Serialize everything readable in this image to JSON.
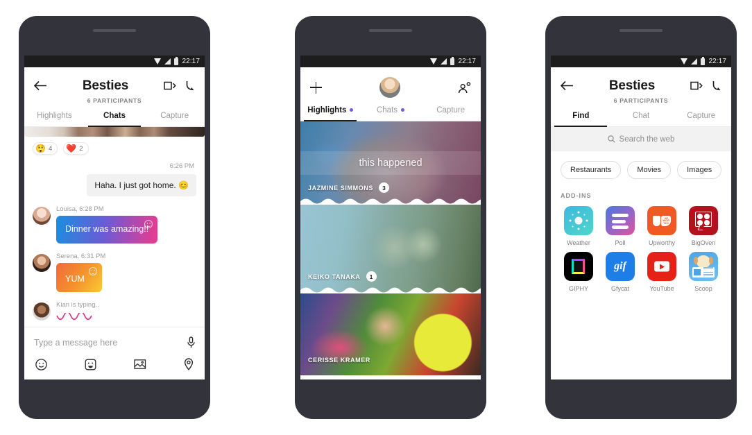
{
  "status_bar": {
    "time": "22:17",
    "wifi_icon": "wifi-icon",
    "signal_icon": "signal-icon",
    "battery_icon": "battery-icon"
  },
  "phone_chats": {
    "header": {
      "back_icon": "back-arrow-icon",
      "title": "Besties",
      "subtitle": "6 PARTICIPANTS",
      "video_icon": "video-call-icon",
      "call_icon": "phone-call-icon"
    },
    "tabs": [
      {
        "label": "Highlights",
        "active": false
      },
      {
        "label": "Chats",
        "active": true
      },
      {
        "label": "Capture",
        "active": false
      }
    ],
    "reactions": [
      {
        "emoji": "😲",
        "name": "surprised-emoji",
        "count": "4"
      },
      {
        "emoji": "❤️",
        "name": "heart-emoji",
        "count": "2"
      }
    ],
    "incoming_time": "6:26 PM",
    "incoming_text": "Haha. I just got home. 😊",
    "messages": [
      {
        "meta": "Louisa, 6:28 PM",
        "text": "Dinner was amazing!!",
        "style": "gradient-blue-pink"
      },
      {
        "meta": "Serena, 6:31 PM",
        "text": "YUM",
        "style": "gradient-orange-yellow"
      }
    ],
    "typing": {
      "text": "Kian is typing..",
      "wave_icon": "typing-wave-icon"
    },
    "composer": {
      "placeholder": "Type a message here",
      "mic_icon": "microphone-icon",
      "actions": [
        {
          "name": "emoji-icon"
        },
        {
          "name": "sticker-icon"
        },
        {
          "name": "photo-icon"
        },
        {
          "name": "location-icon"
        }
      ]
    }
  },
  "phone_highlights": {
    "header": {
      "add_icon": "plus-icon",
      "avatar": "profile-avatar",
      "add_people_icon": "add-person-icon"
    },
    "tabs": [
      {
        "label": "Highlights",
        "active": true,
        "dot": true
      },
      {
        "label": "Chats",
        "active": false,
        "dot": true
      },
      {
        "label": "Capture",
        "active": false,
        "dot": false
      }
    ],
    "cards": [
      {
        "name": "JAZMINE SIMMONS",
        "badge": "3",
        "caption": "this happened"
      },
      {
        "name": "KEIKO TANAKA",
        "badge": "1",
        "caption": ""
      },
      {
        "name": "CERISSE KRAMER",
        "badge": "",
        "caption": ""
      }
    ]
  },
  "phone_find": {
    "header": {
      "back_icon": "back-arrow-icon",
      "title": "Besties",
      "subtitle": "6 PARTICIPANTS",
      "video_icon": "video-call-icon",
      "call_icon": "phone-call-icon"
    },
    "tabs": [
      {
        "label": "Find",
        "active": true
      },
      {
        "label": "Chat",
        "active": false
      },
      {
        "label": "Capture",
        "active": false
      }
    ],
    "search": {
      "placeholder": "Search the web",
      "icon": "search-icon"
    },
    "chips": [
      "Restaurants",
      "Movies",
      "Images"
    ],
    "addins_label": "ADD-INS",
    "addins": [
      {
        "label": "Weather",
        "icon": "weather-app-icon"
      },
      {
        "label": "Poll",
        "icon": "poll-app-icon"
      },
      {
        "label": "Upworthy",
        "icon": "upworthy-app-icon"
      },
      {
        "label": "BigOven",
        "icon": "bigoven-app-icon"
      },
      {
        "label": "GIPHY",
        "icon": "giphy-app-icon"
      },
      {
        "label": "Gfycat",
        "icon": "gfycat-app-icon"
      },
      {
        "label": "YouTube",
        "icon": "youtube-app-icon"
      },
      {
        "label": "Scoop",
        "icon": "scoop-app-icon"
      }
    ],
    "gfycat_glyph": "gif"
  },
  "colors": {
    "frame": "#32333b",
    "accent_dot": "#6b5ce7",
    "active_tab": "#1b1b1b"
  }
}
